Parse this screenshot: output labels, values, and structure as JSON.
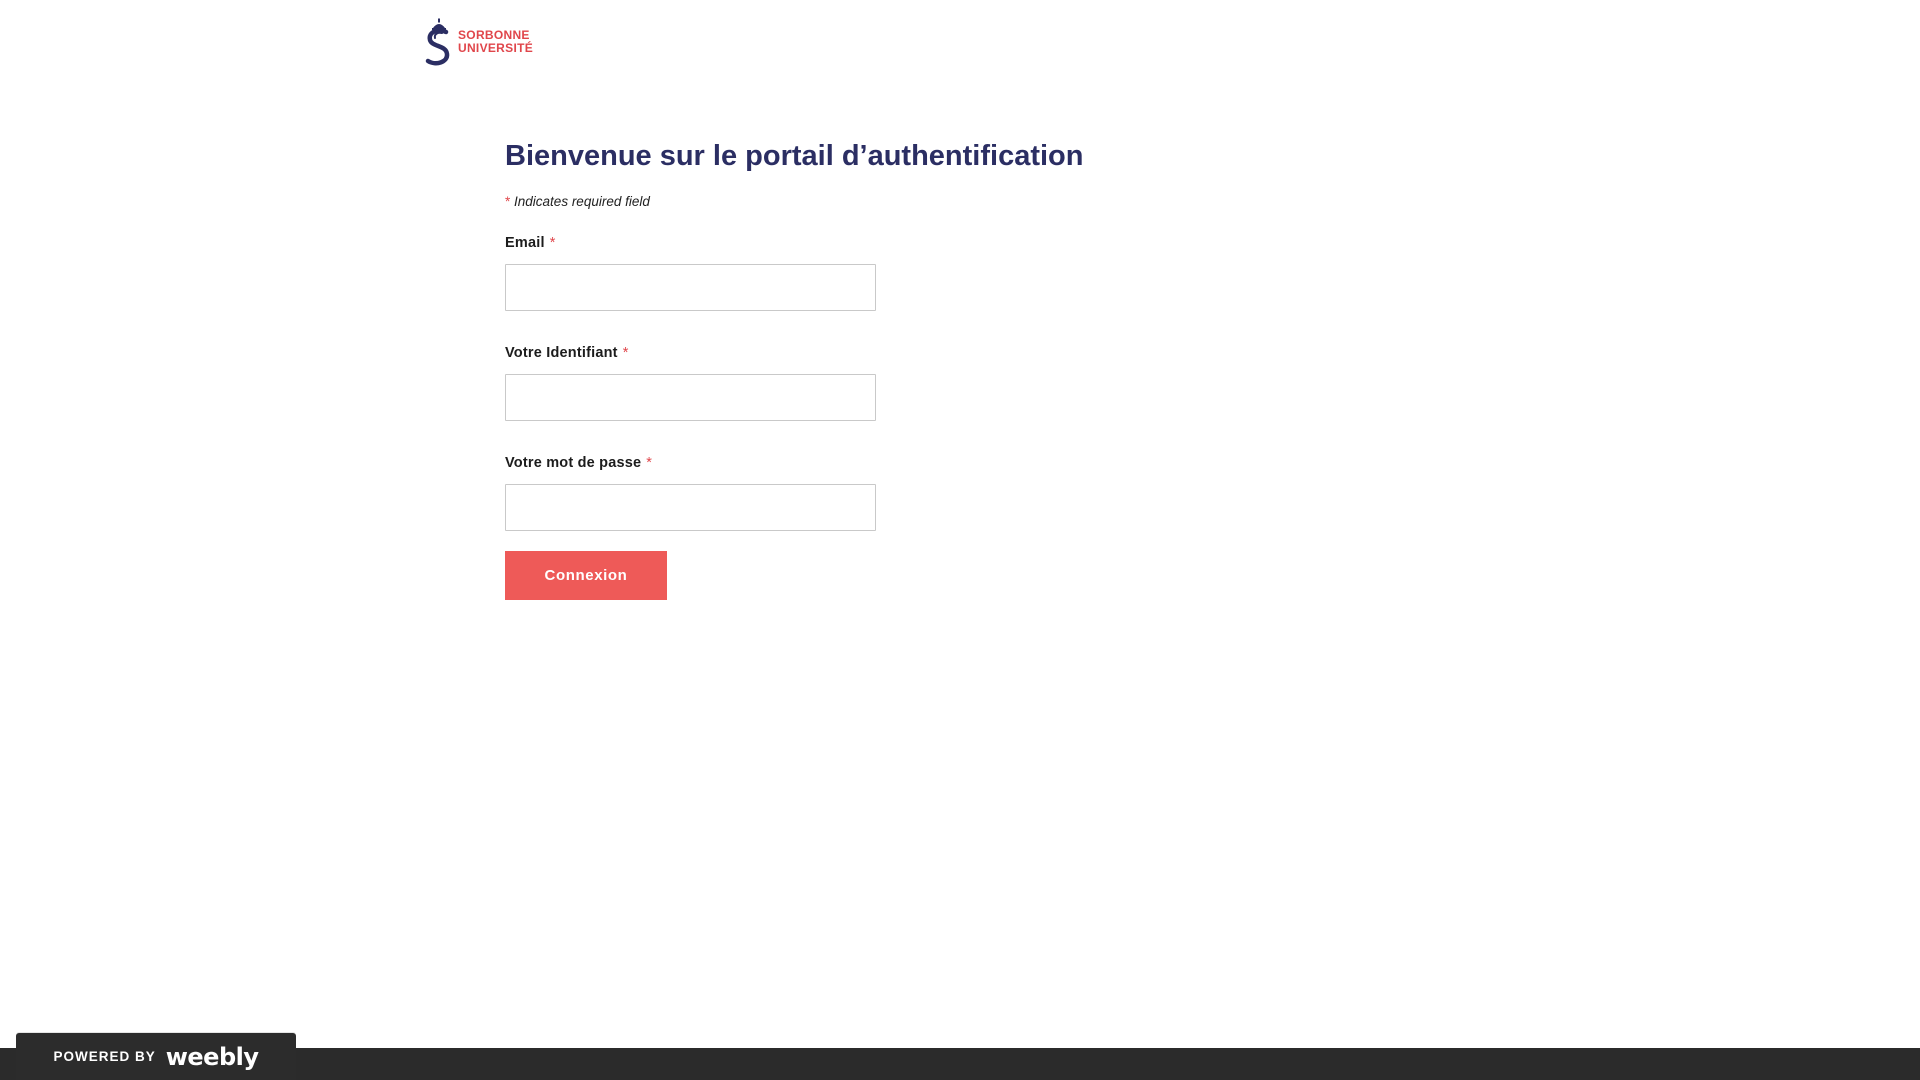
{
  "header": {
    "logo": {
      "line1": "SORBONNE",
      "line2": "UNIVERSITÉ",
      "colors": {
        "mark": "#2b2e63",
        "text": "#e0464b"
      }
    }
  },
  "form": {
    "title": "Bienvenue sur le portail d’authentification",
    "required_note": {
      "asterisk": "*",
      "text": "Indicates required field"
    },
    "fields": [
      {
        "label": "Email",
        "asterisk": "*",
        "value": "",
        "placeholder": ""
      },
      {
        "label": "Votre Identifiant",
        "asterisk": "*",
        "value": "",
        "placeholder": ""
      },
      {
        "label": "Votre mot de passe",
        "asterisk": "*",
        "value": "",
        "placeholder": ""
      }
    ],
    "submit_label": "Connexion",
    "colors": {
      "title": "#2b2e63",
      "required": "#e0464b",
      "button": "#ee5a58"
    }
  },
  "footer": {
    "powered_by": "POWERED BY",
    "brand": "weebly"
  }
}
